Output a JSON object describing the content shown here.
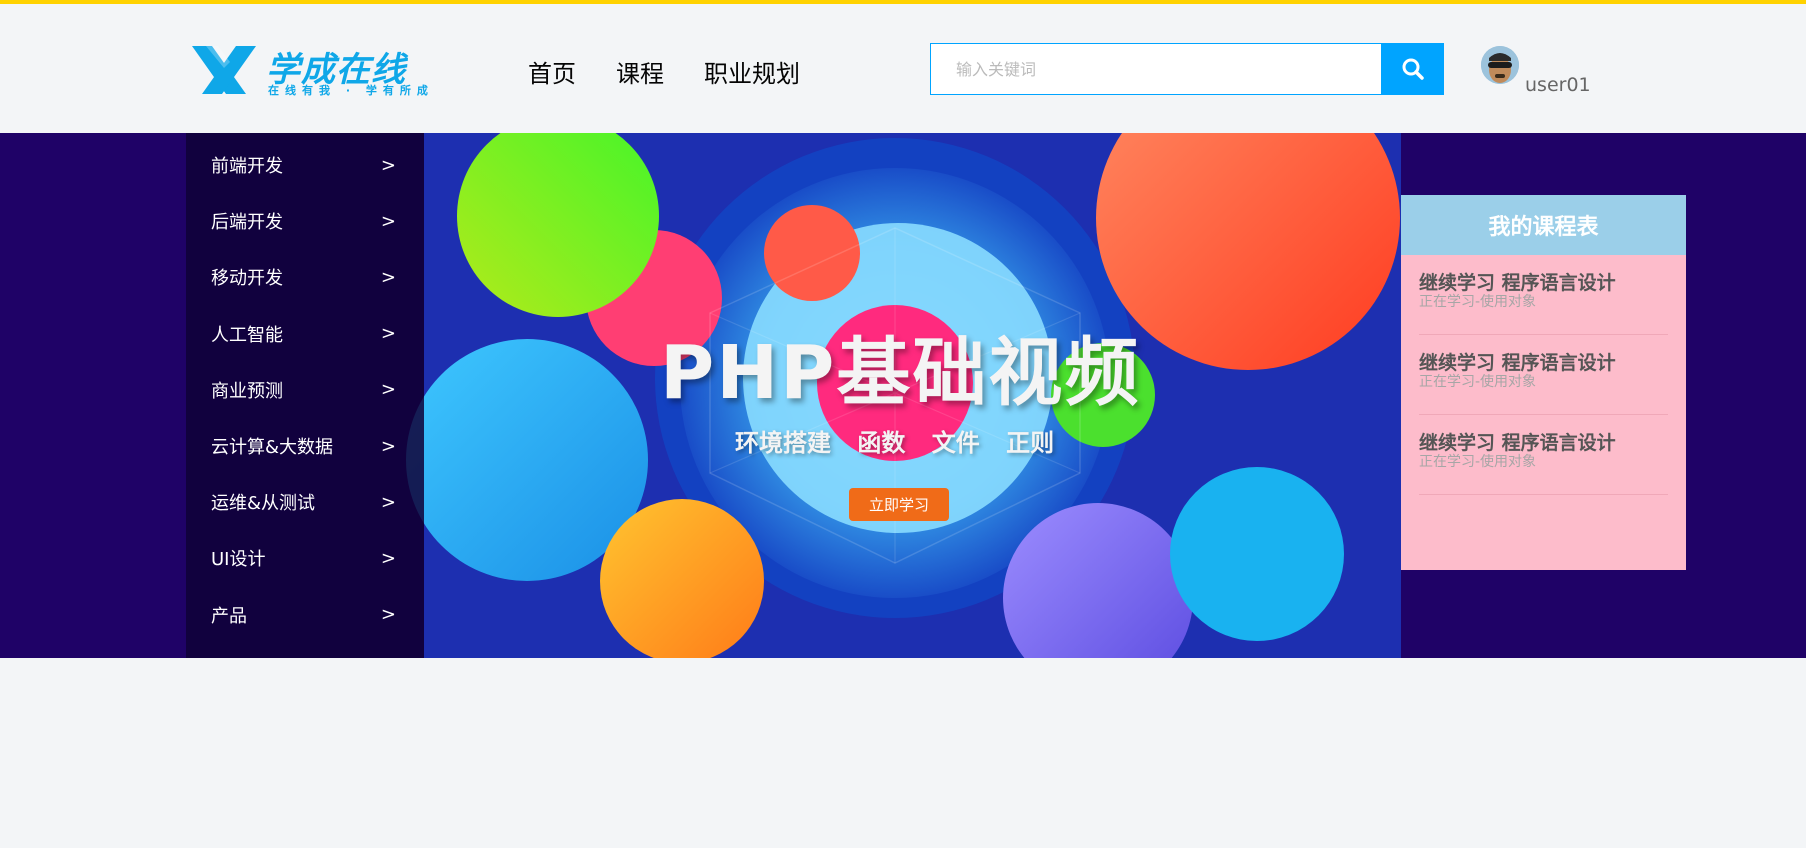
{
  "logo": {
    "title": "学成在线",
    "slogan": "在线有我 · 学有所成"
  },
  "nav": {
    "items": [
      "首页",
      "课程",
      "职业规划"
    ]
  },
  "search": {
    "placeholder": "输入关键词",
    "button_icon": "search-icon"
  },
  "user": {
    "name": "user01",
    "avatar_icon": "avatar-icon"
  },
  "category_menu": {
    "items": [
      {
        "label": "前端开发",
        "arrow": ">"
      },
      {
        "label": "后端开发",
        "arrow": ">"
      },
      {
        "label": "移动开发",
        "arrow": ">"
      },
      {
        "label": "人工智能",
        "arrow": ">"
      },
      {
        "label": "商业预测",
        "arrow": ">"
      },
      {
        "label": "云计算&大数据",
        "arrow": ">"
      },
      {
        "label": "运维&从测试",
        "arrow": ">"
      },
      {
        "label": "UI设计",
        "arrow": ">"
      },
      {
        "label": "产品",
        "arrow": ">"
      }
    ]
  },
  "banner": {
    "title": "PHP基础视频",
    "subtitle": "环境搭建 函数 文件 正则",
    "cta": "立即学习"
  },
  "course_table": {
    "title": "我的课程表",
    "items": [
      {
        "title": "继续学习 程序语言设计",
        "subtitle": "正在学习-使用对象"
      },
      {
        "title": "继续学习 程序语言设计",
        "subtitle": "正在学习-使用对象"
      },
      {
        "title": "继续学习 程序语言设计",
        "subtitle": "正在学习-使用对象"
      }
    ]
  },
  "colors": {
    "accent": "#00a4ff",
    "top_strip": "#ffd200",
    "banner_bg": "#1f0267",
    "course_table_head": "#9bcfe9",
    "course_table_body": "#fdbccb"
  }
}
